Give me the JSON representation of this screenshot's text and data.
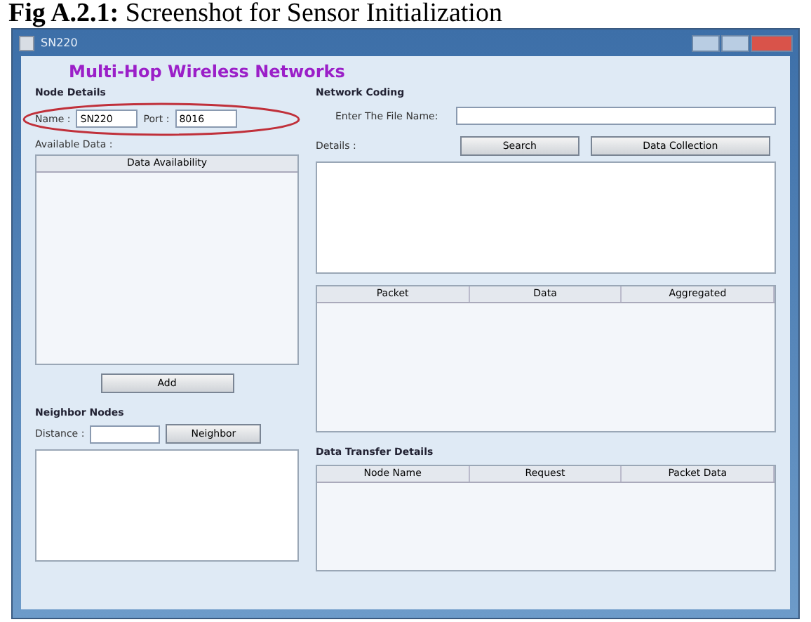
{
  "caption": "**Fig A.2.1:** Screenshot for Sensor Initialization",
  "window": {
    "title": "SN220"
  },
  "heading": "Multi-Hop Wireless Networks",
  "node_details": {
    "title": "Node Details",
    "name": {
      "label": "Name :",
      "value": "SN220"
    },
    "port": {
      "label": "Port :",
      "value": "8016"
    }
  },
  "available_data": {
    "label": "Available Data :",
    "list_header": "Data Availability"
  },
  "add_button": "Add",
  "neighbor_nodes": {
    "title": "Neighbor Nodes",
    "distance_label": "Distance :",
    "button": "Neighbor"
  },
  "network_coding": {
    "title": "Network Coding",
    "file_label": "Enter The File Name:",
    "buttons": [
      "Search",
      "Data Collection"
    ],
    "details_label": "Details :"
  },
  "packet_table": {
    "columns": [
      "Packet",
      "Data",
      "Aggregated"
    ]
  },
  "data_transfer": {
    "title": "Data Transfer Details",
    "columns": [
      "Node Name",
      "Request",
      "Packet Data"
    ]
  }
}
